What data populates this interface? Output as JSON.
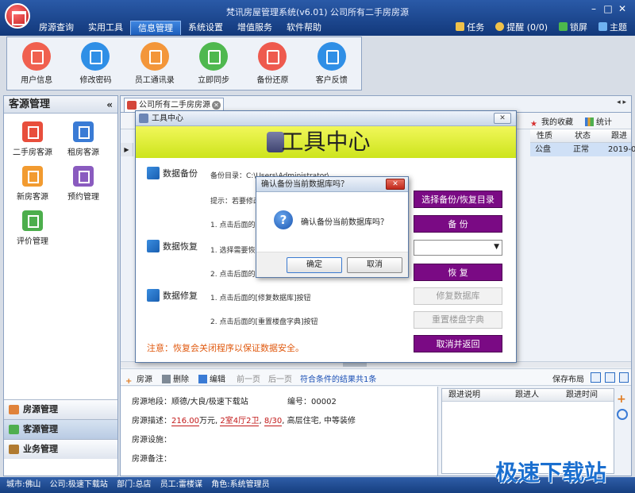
{
  "window": {
    "title": "梵讯房屋管理系统(v6.01) 公司所有二手房房源"
  },
  "menu": [
    "房源查询",
    "实用工具",
    "信息管理",
    "系统设置",
    "增值服务",
    "软件帮助"
  ],
  "toolstrip": [
    {
      "label": "任务",
      "icon": "task-icon"
    },
    {
      "label": "提醒 (0/0)",
      "icon": "bell-icon"
    },
    {
      "label": "锁屏",
      "icon": "lock-icon"
    },
    {
      "label": "主题",
      "icon": "shirt-icon"
    }
  ],
  "ribbon": [
    {
      "label": "用户信息",
      "color": "#f0604f"
    },
    {
      "label": "修改密码",
      "color": "#2f8fe6"
    },
    {
      "label": "员工通讯录",
      "color": "#f3963a"
    },
    {
      "label": "立即同步",
      "color": "#4fb84f"
    },
    {
      "label": "备份还原",
      "color": "#ee5a4e"
    },
    {
      "label": "客户反馈",
      "color": "#2f8fe6"
    }
  ],
  "left": {
    "title": "客源管理",
    "collapse": "«",
    "icons": [
      {
        "label": "二手房客源",
        "color": "#e84e3c"
      },
      {
        "label": "租房客源",
        "color": "#3a7bd5"
      },
      {
        "label": "新房客源",
        "color": "#f29b30"
      },
      {
        "label": "预约管理",
        "color": "#8a5bbf"
      },
      {
        "label": "评价管理",
        "color": "#4cae4c"
      }
    ],
    "sections": [
      "房源管理",
      "客源管理",
      "业务管理"
    ]
  },
  "main": {
    "tab": "公司所有二手房房源",
    "tabnav": "◂ ▸",
    "toolbar": {
      "favorites": "我的收藏",
      "stats": "统计"
    },
    "grid": {
      "headers": [
        "性质",
        "状态",
        "跟进"
      ],
      "row": [
        "公盘",
        "正常",
        "2019-0"
      ]
    },
    "detailbar": {
      "add": "房源",
      "delete": "删除",
      "edit": "编辑",
      "prev": "前一页",
      "next": "后一页",
      "result": "符合条件的结果共1条",
      "layout": "保存布局"
    },
    "detail": {
      "location_label": "房源地段：",
      "location": "顺德/大良/极速下载站",
      "number_label": "编号：",
      "number": "00002",
      "desc_label": "房源描述：",
      "price": "216.00",
      "price_unit": "万元,",
      "rooms": "2室4厅2卫",
      "floor": "8/30",
      "desc_rest": "高层住宅, 中等装修",
      "facility_label": "房源设施：",
      "remark_label": "房源备注："
    },
    "follow": {
      "headers": [
        "跟进说明",
        "跟进人",
        "跟进时间"
      ]
    }
  },
  "status": {
    "city": "城市:佛山",
    "company": "公司:极速下载站",
    "dept": "部门:总店",
    "staff": "员工:雷楼谋",
    "role": "角色:系统管理员"
  },
  "tool_center": {
    "title": "工具中心",
    "close": "✕",
    "banner": "工具中心",
    "backup_label": "数据备份",
    "backup_dir": "备份目录：C:\\Users\\Administrator\\Desktop\\导出",
    "backup_hint": "提示：若要修改",
    "backup_step1": "1. 点击后面的[",
    "restore_label": "数据恢复",
    "restore_step1": "1. 选择需要恢",
    "restore_step2": "2. 点击后面的[",
    "repair_label": "数据修复",
    "repair_step1": "1. 点击后面的[修复数据库]按钮",
    "repair_step2": "2. 点击后面的[重置楼盘字典]按钮",
    "note": "注意：恢复会关闭程序以保证数据安全。",
    "btn_select_dir": "选择备份/恢复目录",
    "btn_backup": "备 份",
    "btn_restore": "恢 复",
    "btn_repair": "修复数据库",
    "btn_reset_dict": "重置楼盘字典",
    "btn_cancel_return": "取消并返回"
  },
  "confirm": {
    "title": "确认备份当前数据库吗？",
    "message": "确认备份当前数据库吗？",
    "ok": "确定",
    "cancel": "取消",
    "close": "✕"
  },
  "watermark": "极速下载站"
}
